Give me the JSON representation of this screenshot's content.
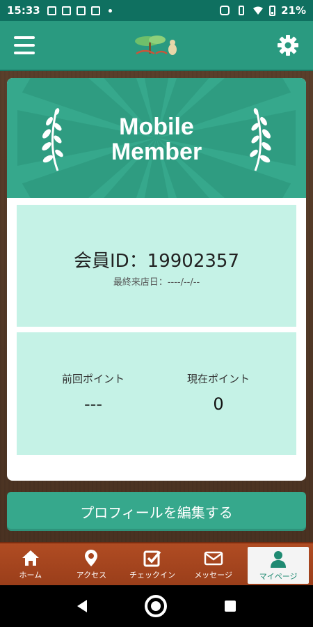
{
  "status_bar": {
    "time": "15:33",
    "battery": "21%"
  },
  "app_bar": {
    "logo_icon": "shop-logo-icon",
    "menu_icon": "hamburger-icon",
    "settings_icon": "gear-icon"
  },
  "card": {
    "banner_line1": "Mobile",
    "banner_line2": "Member",
    "member_id": "会員ID：19902357",
    "last_visit": "最終来店日：----/--/--",
    "points": {
      "previous_label": "前回ポイント",
      "previous_value": "---",
      "current_label": "現在ポイント",
      "current_value": "0"
    }
  },
  "edit_button_label": "プロフィールを編集する",
  "tabs": [
    {
      "label": "ホーム",
      "icon": "home-icon"
    },
    {
      "label": "アクセス",
      "icon": "map-pin-icon"
    },
    {
      "label": "チェックイン",
      "icon": "checkbox-icon"
    },
    {
      "label": "メッセージ",
      "icon": "mail-icon"
    },
    {
      "label": "マイページ",
      "icon": "person-icon",
      "active": true
    }
  ],
  "colors": {
    "primary": "#36a88c",
    "primary_dark": "#0f7060",
    "panel": "#c5f2e6",
    "tab_bar": "#b04c23"
  }
}
